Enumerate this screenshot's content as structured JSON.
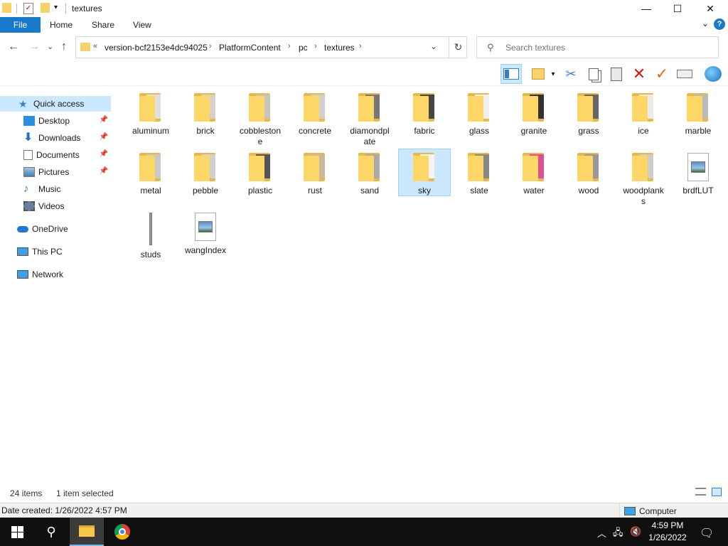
{
  "window": {
    "title": "textures",
    "controls": {
      "minimize": "—",
      "maximize": "☐",
      "close": "✕"
    }
  },
  "ribbon": {
    "tabs": [
      "File",
      "Home",
      "Share",
      "View"
    ],
    "expand_glyph": "⌄",
    "help_glyph": "?"
  },
  "address": {
    "overflow": "«",
    "crumbs": [
      "version-bcf2153e4dc94025",
      "PlatformContent",
      "pc",
      "textures"
    ],
    "separator": "›",
    "refresh_glyph": "↻",
    "dropdown_glyph": "⌄"
  },
  "nav_buttons": {
    "back": "←",
    "forward": "→",
    "recent": "⌄",
    "up": "↑"
  },
  "search": {
    "placeholder": "Search textures",
    "value": ""
  },
  "nav_pane": {
    "items": [
      {
        "label": "Quick access",
        "icon": "star-icon",
        "selected": true
      },
      {
        "label": "Desktop",
        "icon": "desktop-icon",
        "pinned": true
      },
      {
        "label": "Downloads",
        "icon": "download-icon",
        "pinned": true
      },
      {
        "label": "Documents",
        "icon": "documents-icon",
        "pinned": true
      },
      {
        "label": "Pictures",
        "icon": "pictures-icon",
        "pinned": true
      },
      {
        "label": "Music",
        "icon": "music-icon"
      },
      {
        "label": "Videos",
        "icon": "videos-icon"
      },
      {
        "label": "OneDrive",
        "icon": "onedrive-icon"
      },
      {
        "label": "This PC",
        "icon": "this-pc-icon"
      },
      {
        "label": "Network",
        "icon": "network-icon"
      }
    ]
  },
  "files": [
    {
      "name": "aluminum",
      "type": "folder"
    },
    {
      "name": "brick",
      "type": "folder"
    },
    {
      "name": "cobblestone",
      "type": "folder",
      "display": "cobbleston\ne"
    },
    {
      "name": "concrete",
      "type": "folder"
    },
    {
      "name": "diamondplate",
      "type": "folder",
      "display": "diamondpl\nate"
    },
    {
      "name": "fabric",
      "type": "folder"
    },
    {
      "name": "glass",
      "type": "folder"
    },
    {
      "name": "granite",
      "type": "folder"
    },
    {
      "name": "grass",
      "type": "folder"
    },
    {
      "name": "ice",
      "type": "folder"
    },
    {
      "name": "marble",
      "type": "folder"
    },
    {
      "name": "metal",
      "type": "folder"
    },
    {
      "name": "pebble",
      "type": "folder"
    },
    {
      "name": "plastic",
      "type": "folder"
    },
    {
      "name": "rust",
      "type": "folder"
    },
    {
      "name": "sand",
      "type": "folder"
    },
    {
      "name": "sky",
      "type": "folder",
      "selected": true
    },
    {
      "name": "slate",
      "type": "folder"
    },
    {
      "name": "water",
      "type": "folder"
    },
    {
      "name": "wood",
      "type": "folder"
    },
    {
      "name": "woodplanks",
      "type": "folder",
      "display": "woodplank\ns"
    },
    {
      "name": "brdfLUT",
      "type": "image"
    },
    {
      "name": "studs",
      "type": "folder-narrow"
    },
    {
      "name": "wangIndex",
      "type": "image"
    }
  ],
  "status": {
    "count": "24 items",
    "selected": "1 item selected",
    "details": "Date created: 1/26/2022 4:57 PM",
    "location": "Computer"
  },
  "taskbar": {
    "time": "4:59 PM",
    "date": "1/26/2022"
  },
  "colors": {
    "accent": "#1979ca",
    "selection": "#cce8ff",
    "folder": "#fcd667"
  }
}
